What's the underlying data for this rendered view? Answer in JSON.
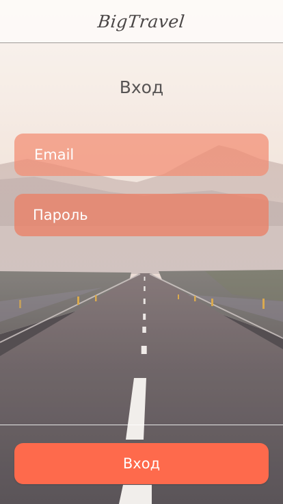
{
  "header": {
    "logo_text": "BigTravel"
  },
  "main": {
    "title": "Вход",
    "email_placeholder": "Email",
    "password_placeholder": "Пароль"
  },
  "footer": {
    "submit_label": "Вход"
  },
  "colors": {
    "accent": "#fe6a4c",
    "field": "#f28c71",
    "text_dark": "#575454"
  }
}
